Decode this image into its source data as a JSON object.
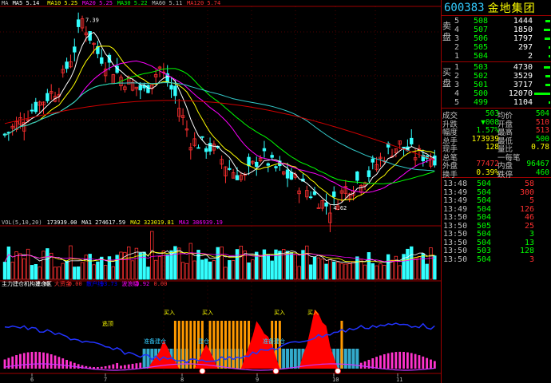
{
  "header": {
    "code": "600383",
    "name": "金地集团"
  },
  "ma_legend": [
    {
      "label": "MA",
      "color": "#c0c0c0"
    },
    {
      "label": "MA5  5.14",
      "color": "#ffffff"
    },
    {
      "label": "MA10 5.25",
      "color": "#ffff00"
    },
    {
      "label": "MA20 5.25",
      "color": "#ff00ff"
    },
    {
      "label": "MA30 5.22",
      "color": "#00ff00"
    },
    {
      "label": "MA60 5.11",
      "color": "#c0c0c0"
    },
    {
      "label": "MA120 5.74",
      "color": "#ff3030"
    }
  ],
  "price_annotations": {
    "high": "7.39",
    "low": "4.62"
  },
  "vol_legend": [
    {
      "label": "VOL(5,10,20)",
      "color": "#c0c0c0"
    },
    {
      "label": "173939.00",
      "color": "#ffffff"
    },
    {
      "label": "MA1 274617.59",
      "color": "#ffffff"
    },
    {
      "label": "MA2 323019.81",
      "color": "#ffff00"
    },
    {
      "label": "MA3 386939.19",
      "color": "#ff00ff"
    }
  ],
  "ind_legend": [
    {
      "label": "主力建仓机构建仓区",
      "color": "#ffffff"
    },
    {
      "label": "0.00",
      "color": "#ffffff"
    },
    {
      "label": "大资金",
      "color": "#ff3030"
    },
    {
      "label": "0.00",
      "color": "#ff3030"
    },
    {
      "label": "散户线",
      "color": "#0000ff"
    },
    {
      "label": "93.73",
      "color": "#0000ff"
    },
    {
      "label": "波浪幅",
      "color": "#ff00ff"
    },
    {
      "label": "0.92",
      "color": "#ff00ff"
    },
    {
      "label": "0.00",
      "color": "#ff3030"
    }
  ],
  "ind_labels": {
    "taoyu": "逃顶",
    "buy": "买入",
    "build": "准备建仓",
    "build2": "建仓",
    "build3": "准备建仓"
  },
  "x_ticks": [
    "6",
    "7",
    "8",
    "9",
    "10",
    "11"
  ],
  "order_book": {
    "sell_tag": "卖盘",
    "buy_tag": "买盘",
    "sell": [
      {
        "lvl": "5",
        "price": "508",
        "vol": "1444",
        "bar": 0.3
      },
      {
        "lvl": "4",
        "price": "507",
        "vol": "1850",
        "bar": 0.38
      },
      {
        "lvl": "3",
        "price": "506",
        "vol": "1797",
        "bar": 0.37
      },
      {
        "lvl": "2",
        "price": "505",
        "vol": "297",
        "bar": 0.06
      },
      {
        "lvl": "1",
        "price": "504",
        "vol": "2",
        "bar": 0.01
      }
    ],
    "buy": [
      {
        "lvl": "1",
        "price": "503",
        "vol": "4730",
        "bar": 0.39
      },
      {
        "lvl": "2",
        "price": "502",
        "vol": "3529",
        "bar": 0.29
      },
      {
        "lvl": "3",
        "price": "501",
        "vol": "3717",
        "bar": 0.31
      },
      {
        "lvl": "4",
        "price": "500",
        "vol": "12070",
        "bar": 1.0
      },
      {
        "lvl": "5",
        "price": "499",
        "vol": "1104",
        "bar": 0.09
      }
    ]
  },
  "stats": [
    {
      "l1": "成交",
      "v1": "503",
      "c1": "g",
      "l2": "均价",
      "v2": "504",
      "c2": "g"
    },
    {
      "l1": "升跌",
      "v1": "▼008",
      "c1": "g",
      "l2": "开盘",
      "v2": "510",
      "c2": "r"
    },
    {
      "l1": "幅度",
      "v1": "1.57%",
      "c1": "g",
      "l2": "最高",
      "v2": "513",
      "c2": "r"
    },
    {
      "l1": "总手",
      "v1": "173939",
      "c1": "y",
      "l2": "最低",
      "v2": "500",
      "c2": "g"
    },
    {
      "l1": "现手",
      "v1": "128",
      "c1": "y",
      "l2": "量比",
      "v2": "0.78",
      "c2": "y"
    },
    {
      "l1": "总笔",
      "v1": "",
      "c1": "w",
      "l2": "一每笔",
      "v2": "",
      "c2": "w"
    },
    {
      "l1": "外盘",
      "v1": "77472",
      "c1": "r",
      "l2": "内盘",
      "v2": "96467",
      "c2": "g"
    },
    {
      "l1": "换手",
      "v1": "0.39%",
      "c1": "y",
      "l2": "跌停",
      "v2": "460",
      "c2": "g"
    }
  ],
  "ticks": [
    {
      "t": "13:48",
      "p": "504",
      "v": "58",
      "c": "r"
    },
    {
      "t": "13:49",
      "p": "504",
      "v": "300",
      "c": "r"
    },
    {
      "t": "13:49",
      "p": "504",
      "v": "5",
      "c": "r"
    },
    {
      "t": "13:49",
      "p": "504",
      "v": "126",
      "c": "r"
    },
    {
      "t": "13:50",
      "p": "504",
      "v": "46",
      "c": "r"
    },
    {
      "t": "13:50",
      "p": "505",
      "v": "25",
      "c": "r"
    },
    {
      "t": "13:50",
      "p": "504",
      "v": "3",
      "c": "g"
    },
    {
      "t": "13:50",
      "p": "504",
      "v": "13",
      "c": "g"
    },
    {
      "t": "13:50",
      "p": "503",
      "v": "128",
      "c": "g"
    },
    {
      "t": "13:50",
      "p": "504",
      "v": "3",
      "c": "r"
    }
  ],
  "colors": {
    "up": "#ff3030",
    "down": "#33ffff",
    "grid": "#a00000",
    "ma5": "#ffffff",
    "ma10": "#ffff00",
    "ma20": "#ff00ff",
    "ma30": "#00ff00",
    "ma60": "#33cccc",
    "ma120": "#cc0000"
  }
}
